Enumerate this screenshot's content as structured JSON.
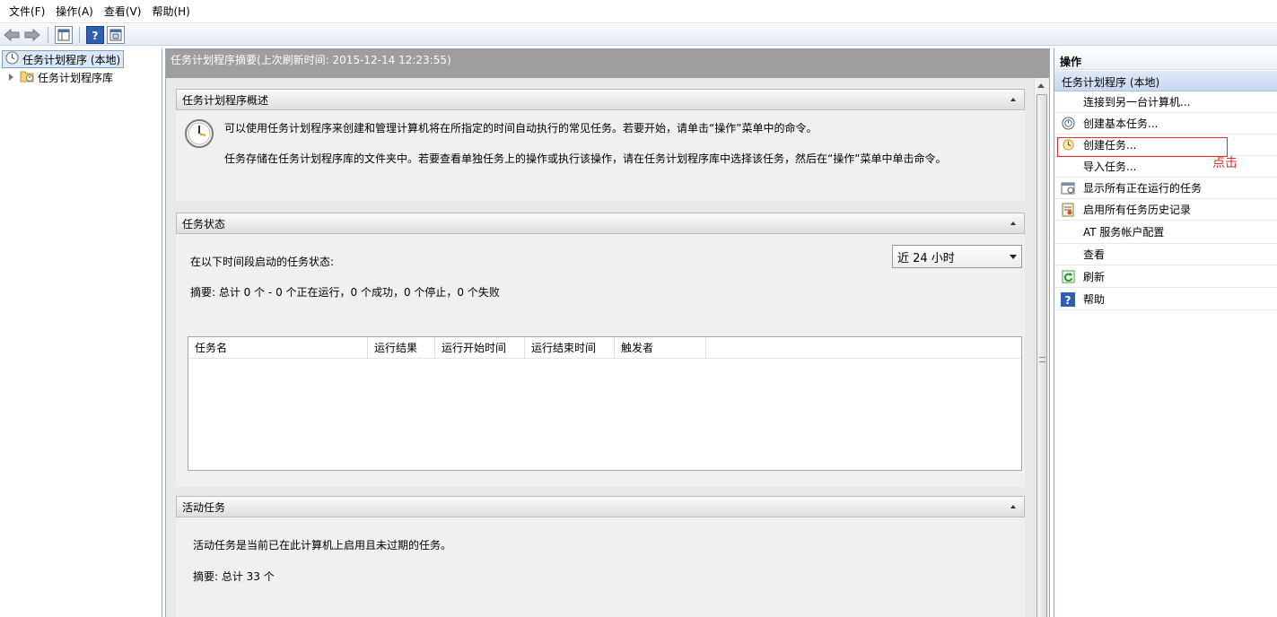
{
  "menu": [
    "文件(F)",
    "操作(A)",
    "查看(V)",
    "帮助(H)"
  ],
  "toolbar": {
    "icons": [
      "back-arrow-icon",
      "forward-arrow-icon",
      "show-console-tree-icon",
      "help-icon",
      "show-action-pane-icon"
    ]
  },
  "tree": {
    "root": "任务计划程序 (本地)",
    "child": "任务计划程序库"
  },
  "center": {
    "header": "任务计划程序摘要(上次刷新时间: 2015-12-14 12:23:55)",
    "overview": {
      "title": "任务计划程序概述",
      "line1": "可以使用任务计划程序来创建和管理计算机将在所指定的时间自动执行的常见任务。若要开始，请单击“操作”菜单中的命令。",
      "line2": "任务存储在任务计划程序库的文件夹中。若要查看单独任务上的操作或执行该操作，请在任务计划程序库中选择该任务，然后在“操作”菜单中单击命令。"
    },
    "status": {
      "title": "任务状态",
      "period_label": "在以下时间段启动的任务状态:",
      "period_value": "近 24 小时",
      "summary": "摘要: 总计 0 个 - 0 个正在运行，0 个成功，0 个停止，0 个失败",
      "columns": [
        "任务名",
        "运行结果",
        "运行开始时间",
        "运行结束时间",
        "触发者"
      ]
    },
    "active": {
      "title": "活动任务",
      "desc": "活动任务是当前已在此计算机上启用且未过期的任务。",
      "summary": "摘要: 总计 33 个"
    }
  },
  "actions": {
    "title": "操作",
    "subtitle": "任务计划程序 (本地)",
    "items": [
      {
        "label": "连接到另一台计算机...",
        "icon": ""
      },
      {
        "label": "创建基本任务...",
        "icon": "create-basic-task-icon"
      },
      {
        "label": "创建任务...",
        "icon": "create-task-icon"
      },
      {
        "label": "导入任务...",
        "icon": ""
      },
      {
        "label": "显示所有正在运行的任务",
        "icon": "running-tasks-icon"
      },
      {
        "label": "启用所有任务历史记录",
        "icon": "task-history-icon"
      },
      {
        "label": "AT 服务帐户配置",
        "icon": ""
      },
      {
        "label": "查看",
        "icon": ""
      },
      {
        "label": "刷新",
        "icon": "refresh-icon"
      },
      {
        "label": "帮助",
        "icon": "help-icon"
      }
    ],
    "annotation": "点击"
  }
}
